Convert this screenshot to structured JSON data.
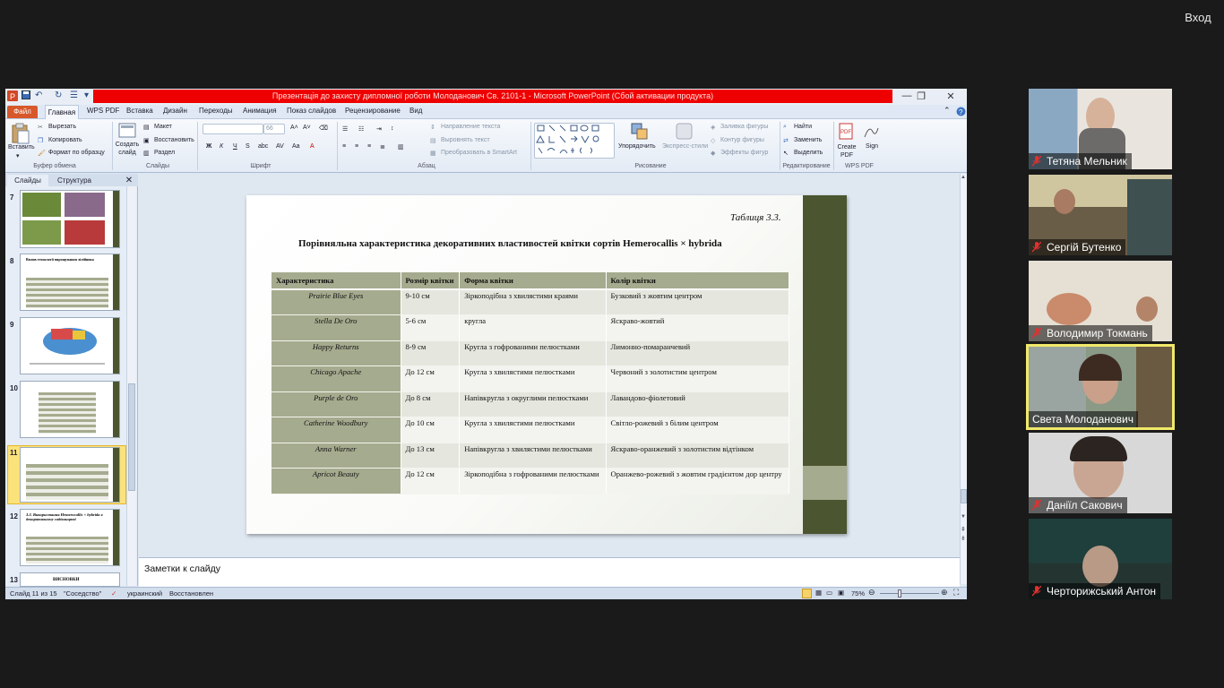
{
  "meeting": {
    "exit_label": "Вход"
  },
  "ppt": {
    "title": "Презентація до захисту дипломної роботи Молоданович Св. 2101-1 - Microsoft PowerPoint (Сбой активации продукта)",
    "tabs": [
      "Файл",
      "Главная",
      "WPS PDF",
      "Вставка",
      "Дизайн",
      "Переходы",
      "Анимация",
      "Показ слайдов",
      "Рецензирование",
      "Вид"
    ],
    "ribbon": {
      "paste": "Вставить",
      "cut": "Вырезать",
      "copy": "Копировать",
      "format_painter": "Формат по образцу",
      "clipboard_group": "Буфер обмена",
      "new_slide": "Создать слайд",
      "layout": "Макет",
      "reset": "Восстановить",
      "section": "Раздел",
      "slides_group": "Слайды",
      "font_size": "66",
      "font_group": "Шрифт",
      "text_direction": "Направление текста",
      "align_text": "Выровнять текст",
      "smartart": "Преобразовать в SmartArt",
      "paragraph_group": "Абзац",
      "arrange": "Упорядочить",
      "quick_styles": "Экспресс-стили",
      "shape_fill": "Заливка фигуры",
      "shape_outline": "Контур фигуры",
      "shape_effects": "Эффекты фигур",
      "drawing_group": "Рисование",
      "find": "Найти",
      "replace": "Заменить",
      "select": "Выделить",
      "editing_group": "Редактирование",
      "create_pdf": "Create PDF",
      "sign": "Sign",
      "wps_group": "WPS PDF"
    },
    "panel_tabs": [
      "Слайды",
      "Структура"
    ],
    "thumb_numbers": [
      "7",
      "8",
      "9",
      "10",
      "11",
      "12",
      "13"
    ],
    "thumb_texts": {
      "t8": "Вплив технології вирощування лілійника",
      "t12": "3.3. Використання Hemerocallis × hybrida в декоративному садівництві",
      "t13": "ВИСНОВКИ"
    },
    "slide": {
      "table_label": "Таблиця 3.3.",
      "heading": "Порівняльна характеристика декоративних властивостей квітки сортів Hemerocallis × hybrida",
      "headers": [
        "Характеристика",
        "Розмір квітки",
        "Форма квітки",
        "Колір квітки"
      ],
      "rows": [
        [
          "Prairie Blue Eyes",
          "9-10 см",
          "Зіркоподібна з хвилястими краями",
          "Бузковий з жовтим центром"
        ],
        [
          "Stella De Oro",
          "5-6 см",
          "кругла",
          "Яскраво-жовтий"
        ],
        [
          "Happy Returns",
          "8-9 см",
          "Кругла з гофрованими пелюстками",
          "Лимонно-помаранчевий"
        ],
        [
          "Chicago Apache",
          "До 12 см",
          "Кругла з хвилястими пелюстками",
          "Червоний з золотистим центром"
        ],
        [
          "Purple de Oro",
          "До 8 см",
          "Напівкругла з округлими пелюстками",
          "Лавандово-фіолетовий"
        ],
        [
          "Catherine Woodbury",
          "До 10 см",
          "Кругла з хвилястими пелюстками",
          "Світло-рожевий з білим центром"
        ],
        [
          "Anna Warner",
          "До 13 см",
          "Напівкругла з хвилястими пелюстками",
          "Яскраво-оранжевий з золотистим відтінком"
        ],
        [
          "Apricot Beauty",
          "До 12 см",
          "Зіркоподібна з гофрованими пелюстками",
          "Оранжево-рожевий з жовтим градієнтом дор центру"
        ]
      ]
    },
    "notes_placeholder": "Заметки к слайду",
    "status": {
      "slide_info": "Слайд 11 из 15",
      "theme": "\"Соседство\"",
      "language": "украинский",
      "recovered": "Восстановлен",
      "zoom": "75%"
    }
  },
  "participants": [
    {
      "name": "Тетяна Мельник",
      "muted": true,
      "active": false
    },
    {
      "name": "Сергій Бутенко",
      "muted": true,
      "active": false
    },
    {
      "name": "Володимир Токмань",
      "muted": true,
      "active": false
    },
    {
      "name": "Света Молоданович",
      "muted": false,
      "active": true
    },
    {
      "name": "Даніїл Сакович",
      "muted": true,
      "active": false
    },
    {
      "name": "Черторижський Антон",
      "muted": true,
      "active": false
    }
  ],
  "colors": {
    "slide_accent": "#4b5530",
    "table_header": "#a5ab8e",
    "ppt_title_red": "#ef0000",
    "active_speaker": "#f0e96a"
  }
}
